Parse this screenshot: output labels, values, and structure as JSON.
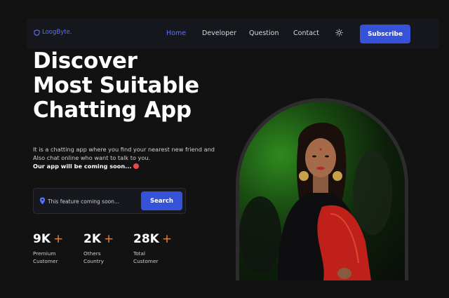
{
  "nav": {
    "logo": "LoogByte.",
    "links": [
      "Home",
      "Developer",
      "Question",
      "Contact"
    ],
    "active_index": 0,
    "subscribe_label": "Subscribe"
  },
  "hero": {
    "title_lines": [
      "Discover",
      "Most Suitable",
      "Chatting App"
    ],
    "description": "It is a chatting app where you find your nearest new friend and Also chat online who want to talk to you.",
    "coming_soon": "Our app will be coming soon..."
  },
  "search": {
    "placeholder": "This feature coming soon...",
    "button_label": "Search"
  },
  "stats": [
    {
      "value": "9K",
      "plus": "+",
      "label_lines": [
        "Premium",
        "Customer"
      ]
    },
    {
      "value": "2K",
      "plus": "+",
      "label_lines": [
        "Others",
        "Country"
      ]
    },
    {
      "value": "28K",
      "plus": "+",
      "label_lines": [
        "Total",
        "Customer"
      ]
    }
  ],
  "colors": {
    "background": "#121212",
    "navbar": "#15171d",
    "accent": "#3552d8",
    "link_active": "#5b74ff",
    "plus": "#e8833a"
  },
  "icons": [
    "shield-icon",
    "sun-icon",
    "location-pin-icon",
    "heart-eyes-emoji-icon"
  ]
}
